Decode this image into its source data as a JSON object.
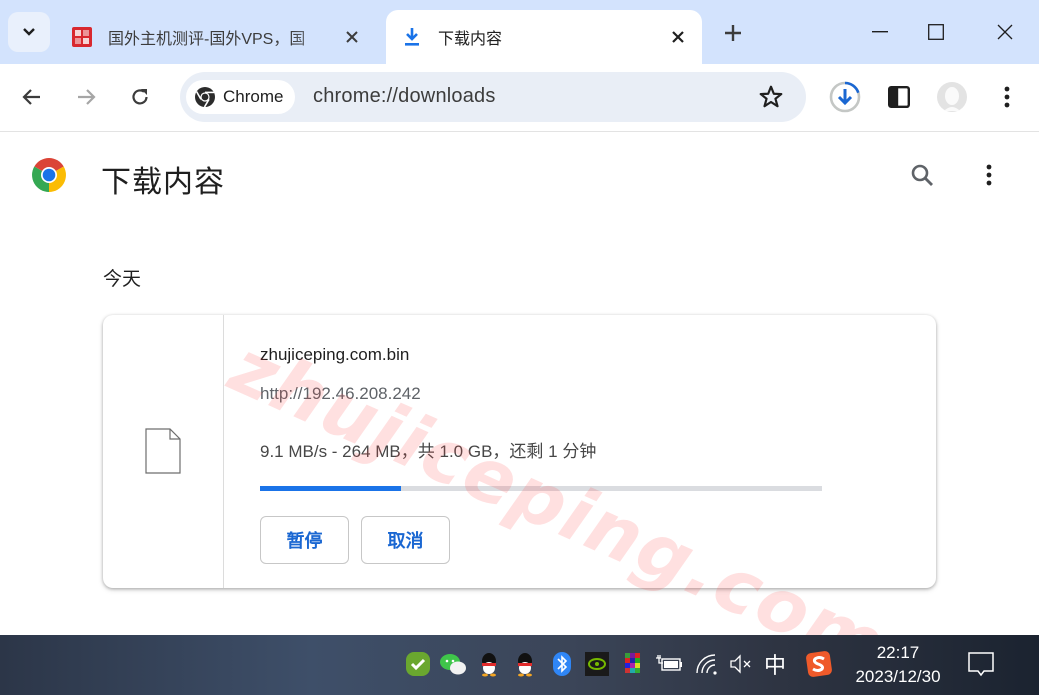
{
  "browser": {
    "tabs": [
      {
        "title": "国外主机测评-国外VPS，国",
        "active": false,
        "favicon": "site-seal-favicon"
      },
      {
        "title": "下载内容",
        "active": true,
        "favicon": "download-icon"
      }
    ],
    "new_tab_label": "+",
    "omnibox": {
      "chip_label": "Chrome",
      "url": "chrome://downloads"
    }
  },
  "page": {
    "title": "下载内容",
    "date_group": "今天",
    "downloads": [
      {
        "filename": "zhujiceping.com.bin",
        "source_url": "http://192.46.208.242",
        "status": "9.1 MB/s - 264 MB，共 1.0 GB，还剩 1 分钟",
        "progress_fraction": 0.25,
        "buttons": {
          "pause": "暂停",
          "cancel": "取消"
        }
      }
    ]
  },
  "watermark": "zhujiceping.com",
  "taskbar": {
    "ime_label": "中",
    "time": "22:17",
    "date": "2023/12/30",
    "tray_icons": [
      "security-check-icon",
      "wechat-icon",
      "qq-icon",
      "qq-icon",
      "bluetooth-icon",
      "nvidia-icon",
      "color-grid-icon",
      "battery-charging-icon",
      "wifi-icon",
      "volume-muted-icon",
      "ime-icon",
      "sogou-icon"
    ]
  },
  "colors": {
    "accent": "#1a73e8",
    "tabstrip": "#d3e3fd",
    "omnibox": "#e9eef6",
    "button_text": "#1a67d2"
  }
}
